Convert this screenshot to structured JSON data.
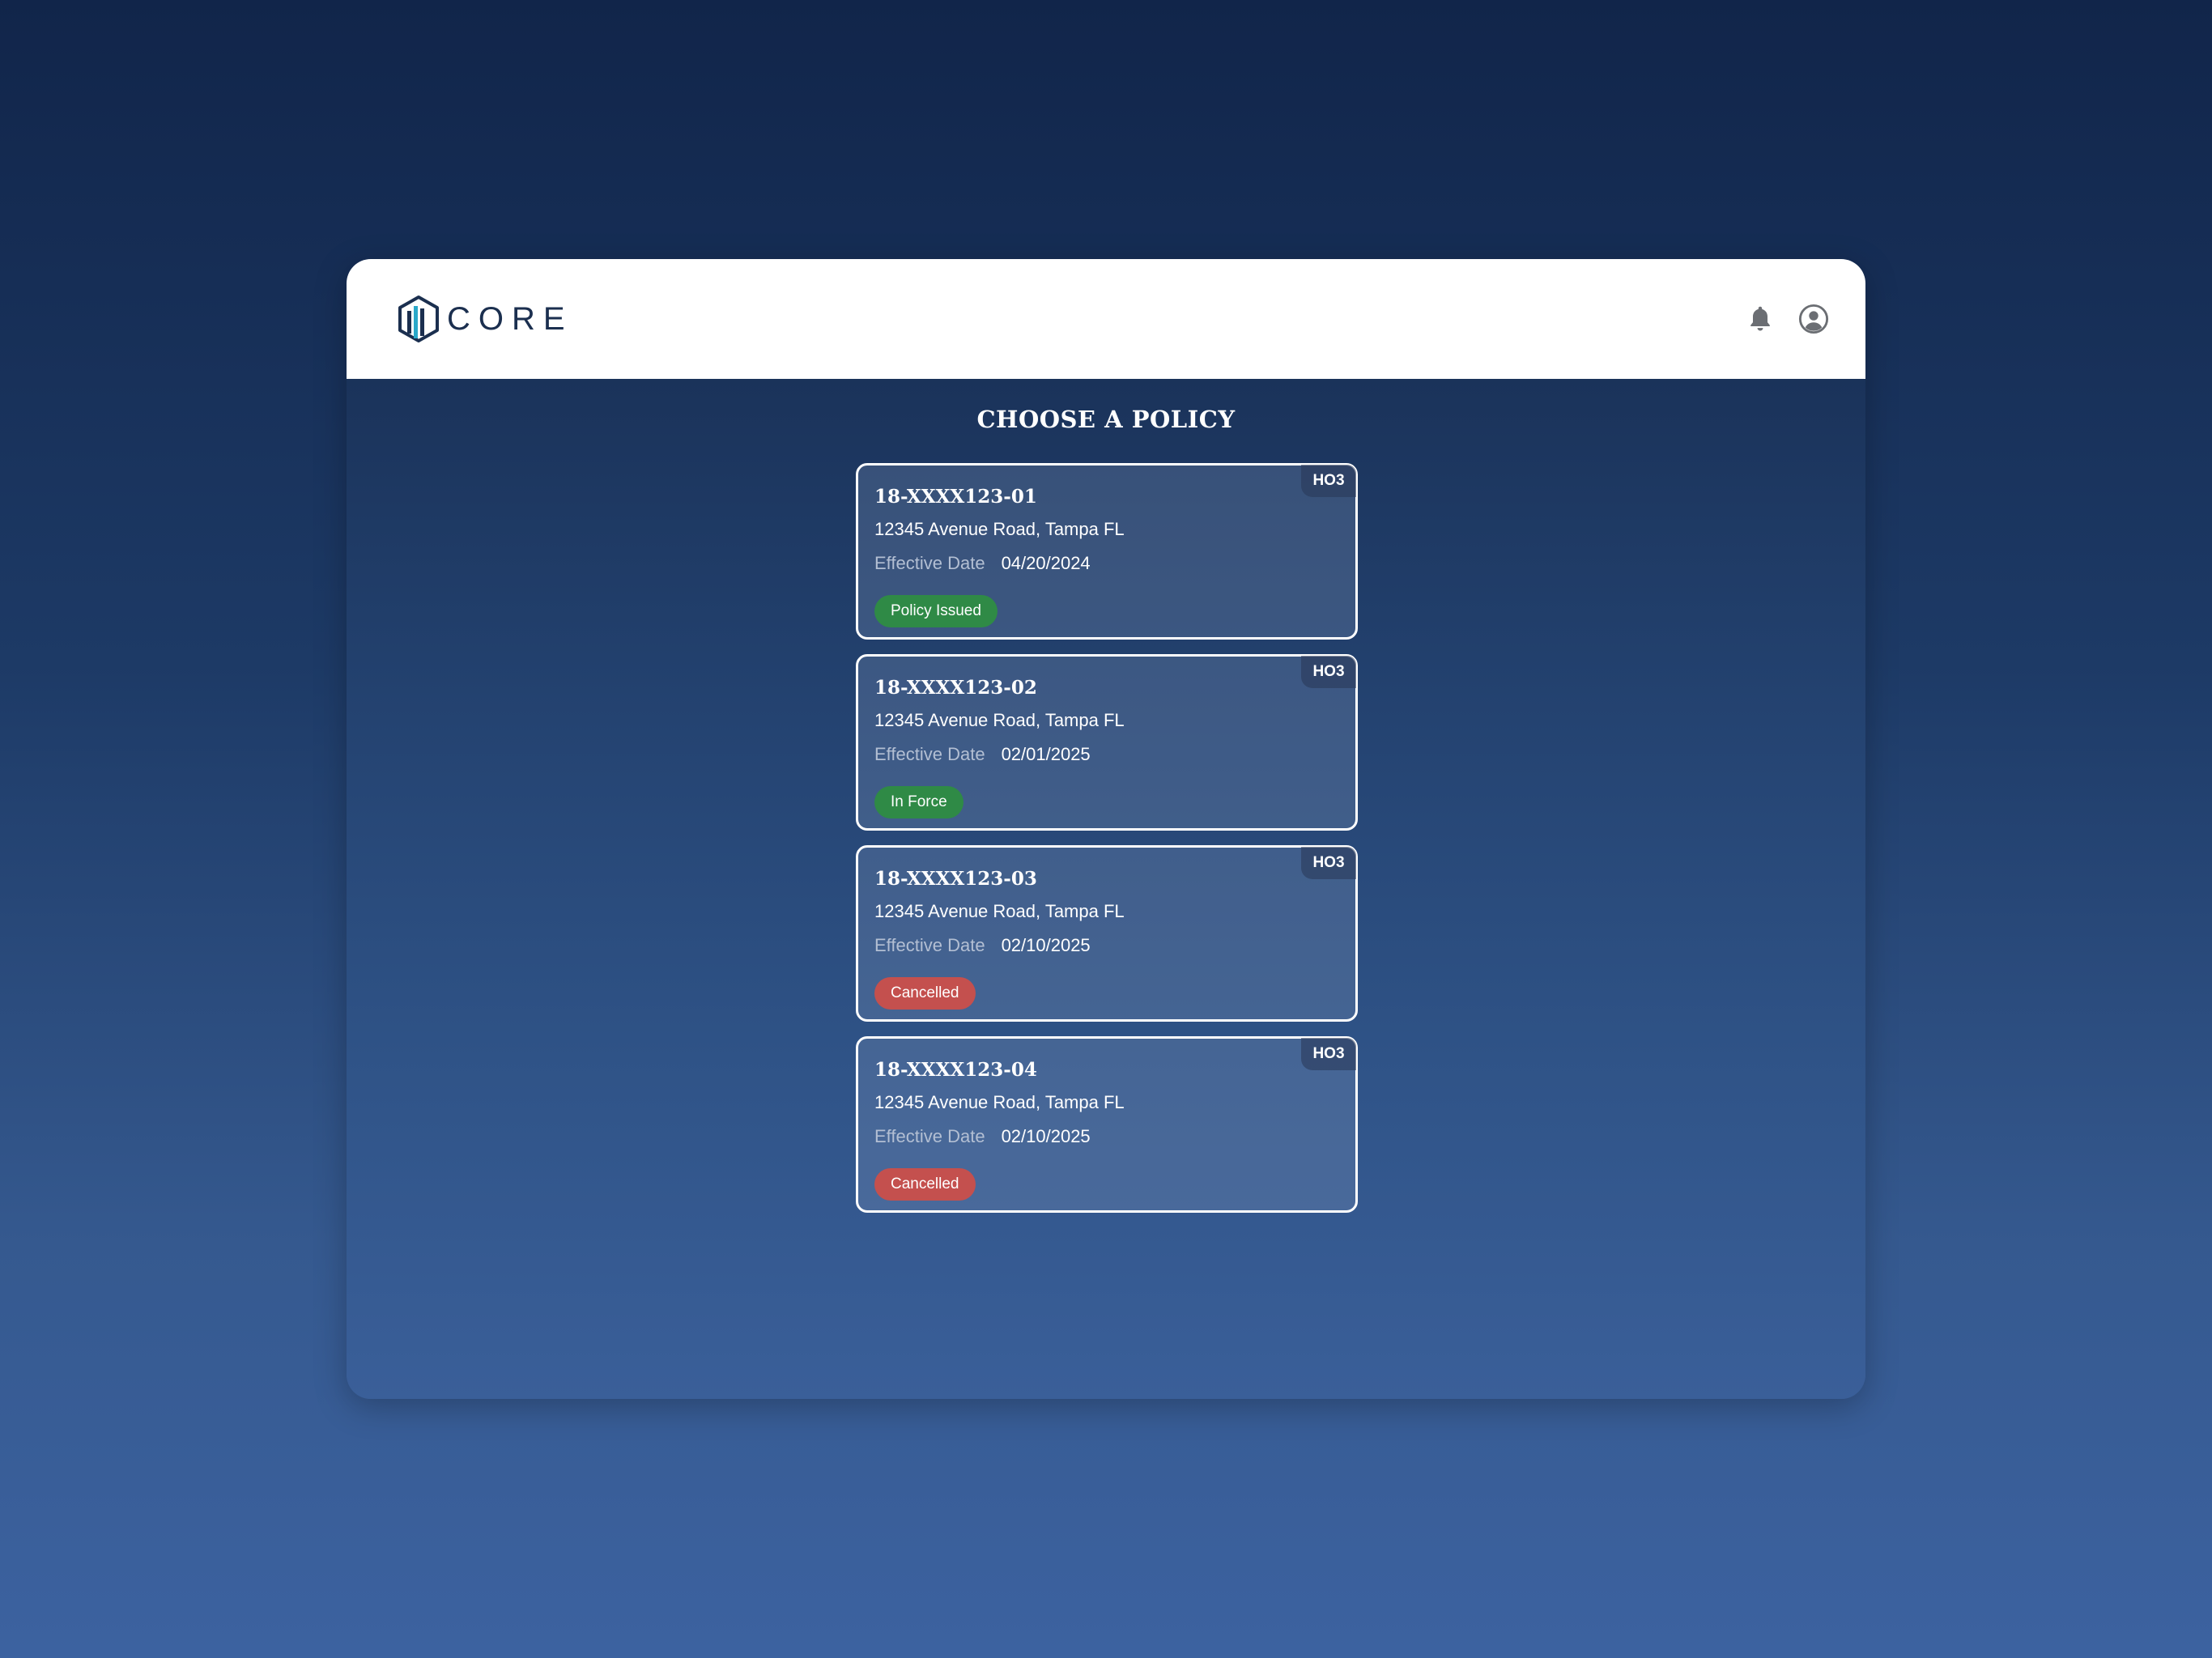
{
  "app": {
    "logo_text": "CORE",
    "page_title": "CHOOSE A POLICY"
  },
  "header": {
    "notifications_icon": "bell-icon",
    "profile_icon": "user-circle-icon"
  },
  "colors": {
    "status_green": "#2f8a46",
    "status_red": "#c4504e"
  },
  "policies": [
    {
      "number": "18-XXXX123-01",
      "type": "HO3",
      "address": "12345 Avenue Road, Tampa FL",
      "effective_label": "Effective Date",
      "effective_date": "04/20/2024",
      "status": "Policy Issued",
      "status_color": "#2f8a46"
    },
    {
      "number": "18-XXXX123-02",
      "type": "HO3",
      "address": "12345 Avenue Road, Tampa FL",
      "effective_label": "Effective Date",
      "effective_date": "02/01/2025",
      "status": "In Force",
      "status_color": "#2f8a46"
    },
    {
      "number": "18-XXXX123-03",
      "type": "HO3",
      "address": "12345 Avenue Road, Tampa FL",
      "effective_label": "Effective Date",
      "effective_date": "02/10/2025",
      "status": "Cancelled",
      "status_color": "#c4504e"
    },
    {
      "number": "18-XXXX123-04",
      "type": "HO3",
      "address": "12345 Avenue Road, Tampa FL",
      "effective_label": "Effective Date",
      "effective_date": "02/10/2025",
      "status": "Cancelled",
      "status_color": "#c4504e"
    }
  ]
}
